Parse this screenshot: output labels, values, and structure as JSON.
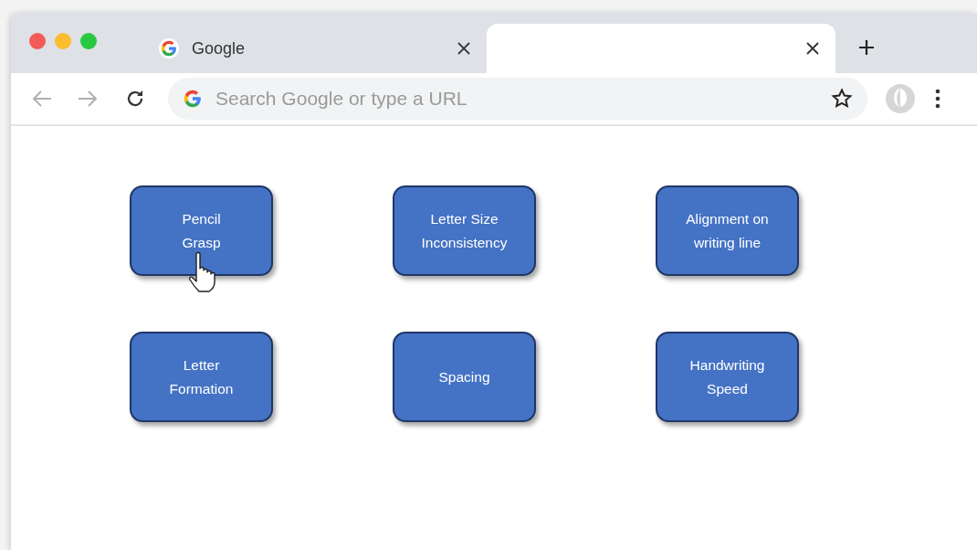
{
  "tabs": [
    {
      "title": "Google",
      "selected": false
    },
    {
      "selected": true
    }
  ],
  "address_bar": {
    "placeholder": "Search Google or type a URL"
  },
  "cards": [
    {
      "lines": [
        "Pencil",
        "Grasp"
      ],
      "hovered": true
    },
    {
      "lines": [
        "Letter Size",
        "Inconsistency"
      ],
      "hovered": false
    },
    {
      "lines": [
        "Alignment on",
        "writing line"
      ],
      "hovered": false
    },
    {
      "lines": [
        "Letter",
        "Formation"
      ],
      "hovered": false
    },
    {
      "lines": [
        "Spacing"
      ],
      "hovered": false
    },
    {
      "lines": [
        "Handwriting",
        "Speed"
      ],
      "hovered": false
    }
  ]
}
